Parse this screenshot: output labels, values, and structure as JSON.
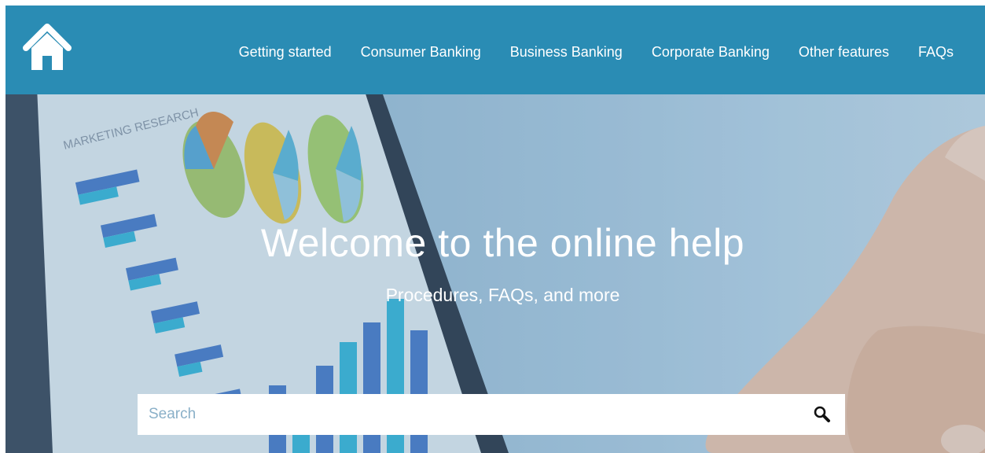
{
  "header": {
    "home_icon": "home-icon",
    "nav": [
      {
        "label": "Getting started"
      },
      {
        "label": "Consumer Banking"
      },
      {
        "label": "Business Banking"
      },
      {
        "label": "Corporate Banking"
      },
      {
        "label": "Other features"
      },
      {
        "label": "FAQs"
      }
    ]
  },
  "hero": {
    "title": "Welcome to the online help",
    "subtitle": "Procedures, FAQs, and more",
    "background_text": "MARKETING RESEARCH"
  },
  "search": {
    "placeholder": "Search",
    "value": "",
    "icon": "search-icon"
  },
  "colors": {
    "header_bg": "#2a8cb4",
    "text_light": "#ffffff",
    "placeholder": "#8ab0c8"
  }
}
